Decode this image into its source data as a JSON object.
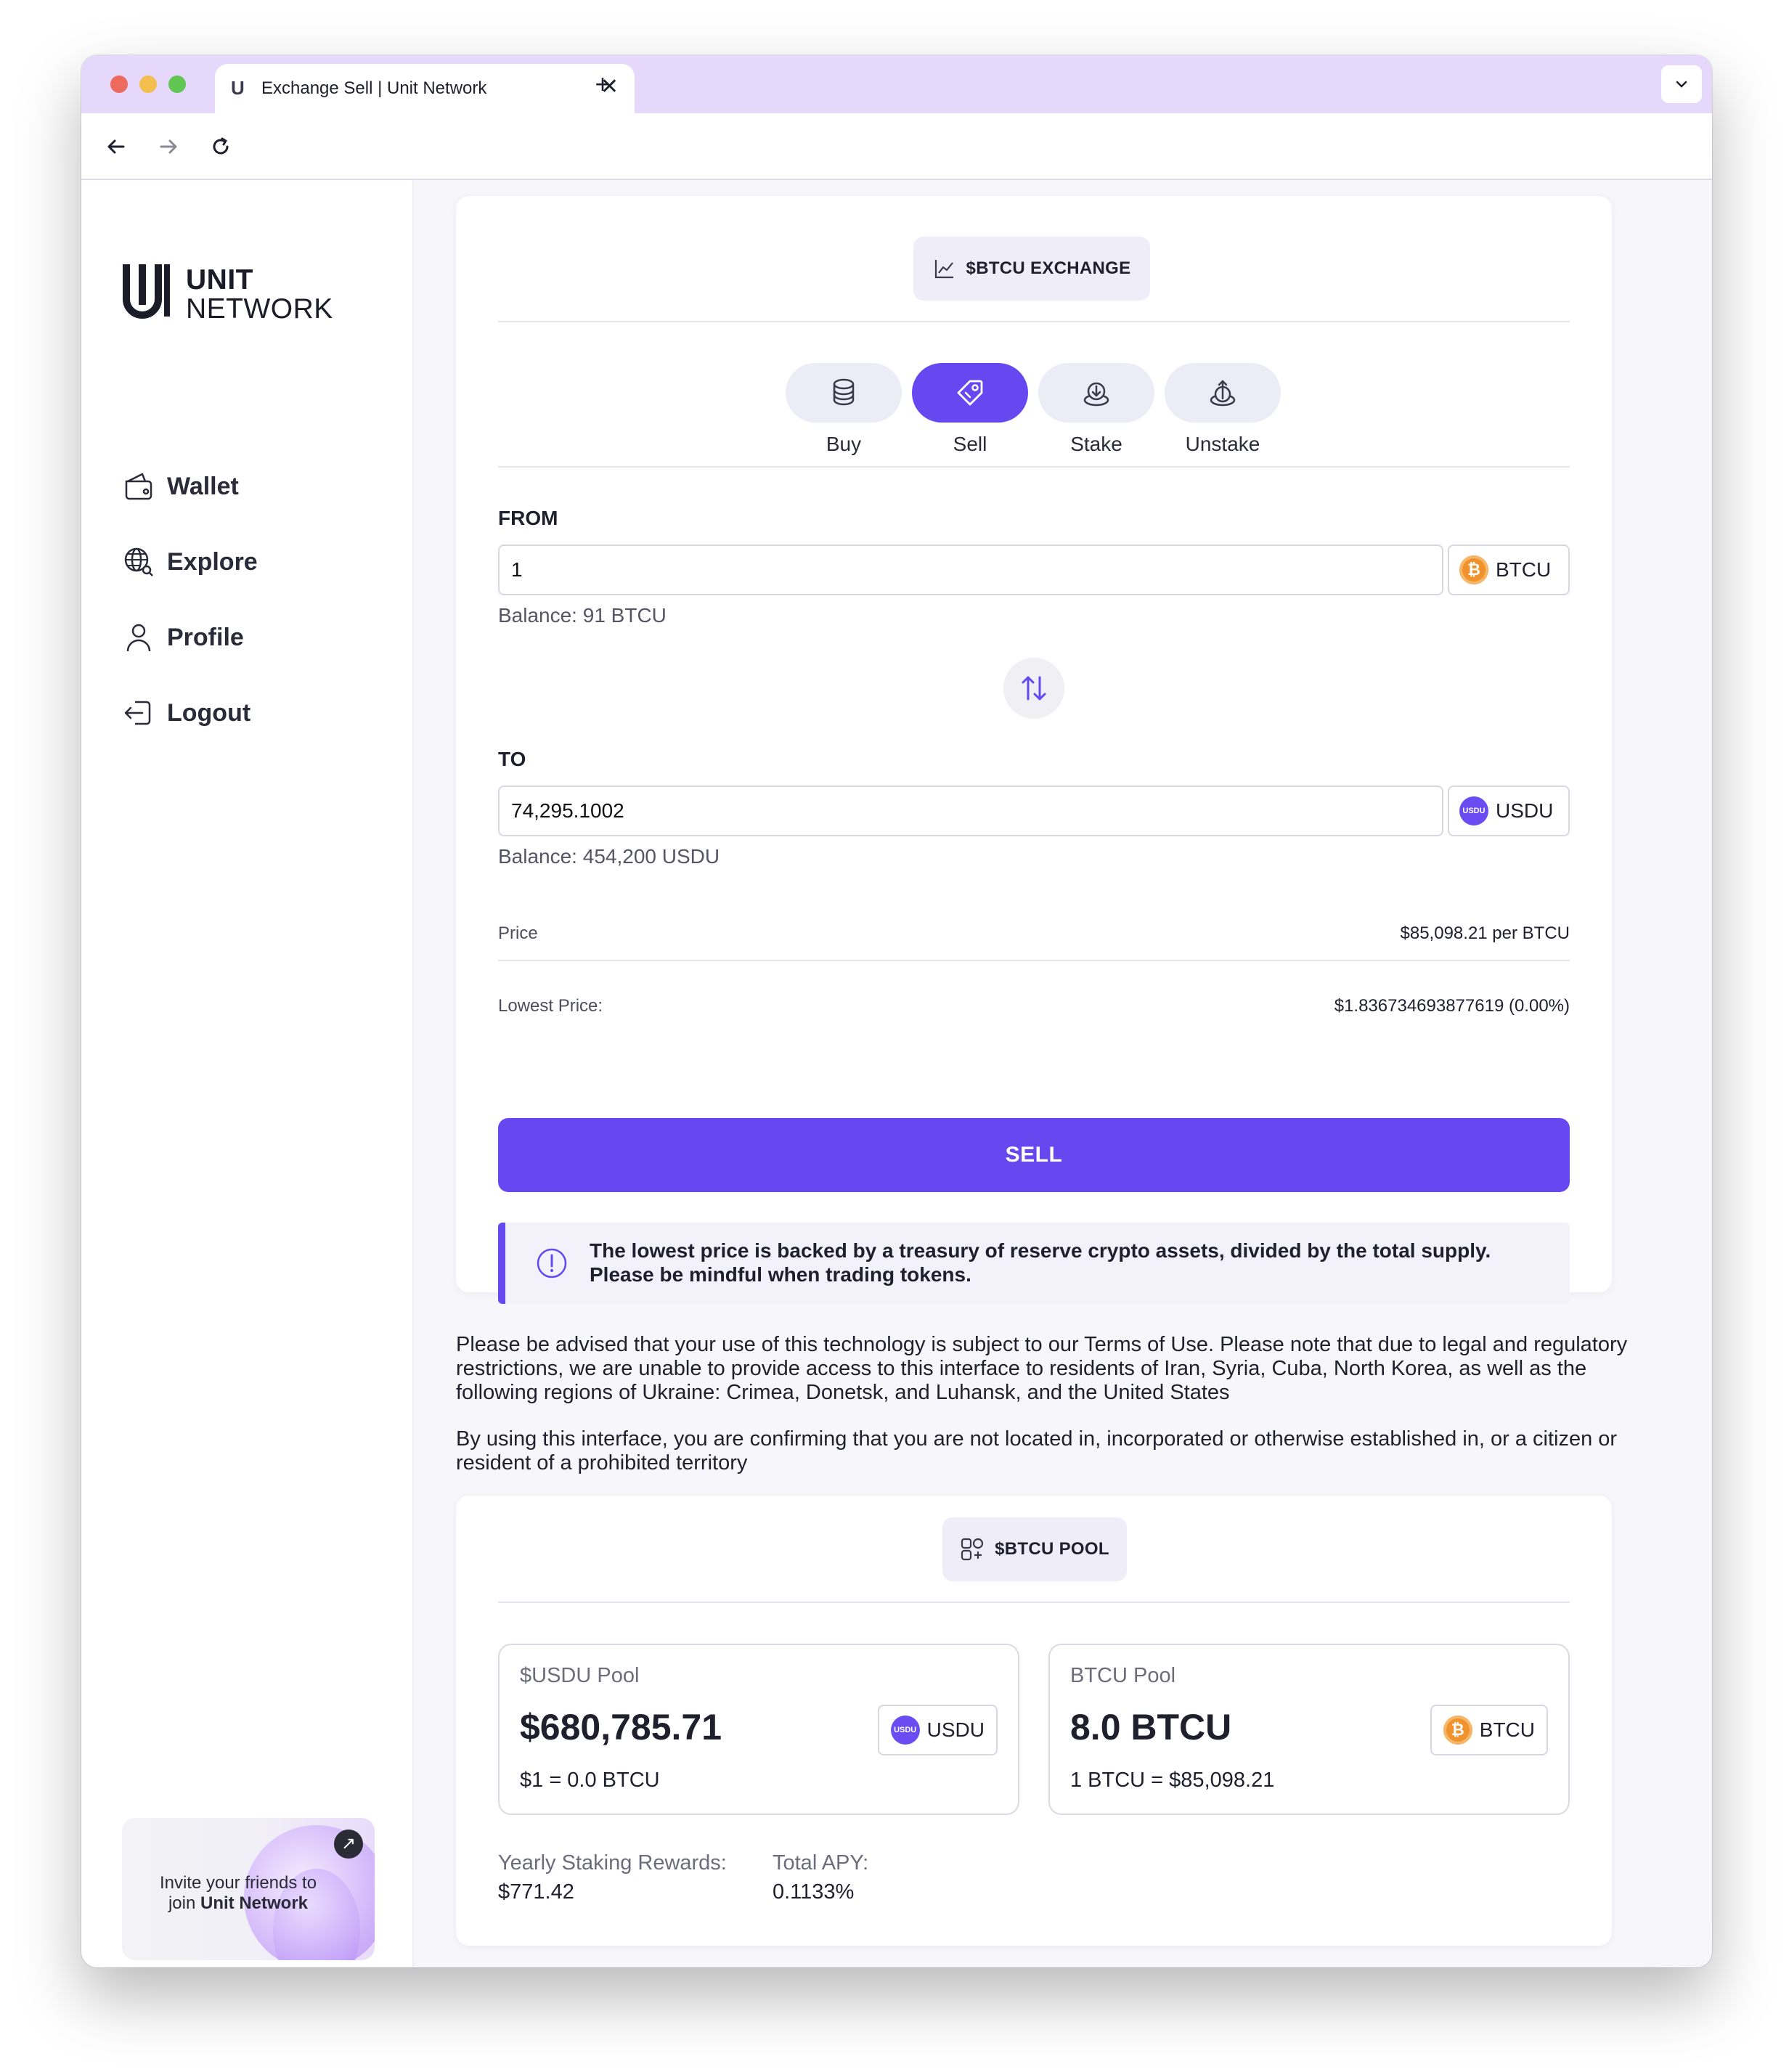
{
  "browser": {
    "tab_favicon": "U",
    "tab_title": "Exchange Sell | Unit Network",
    "close": "✕",
    "new_tab": "+",
    "menu": "⌄",
    "back": "←",
    "forward": "→",
    "reload": "↻"
  },
  "sidebar": {
    "logo": {
      "line1": "UNIT",
      "line2": "NETWORK"
    },
    "items": [
      {
        "label": "Wallet",
        "icon": "wallet-icon"
      },
      {
        "label": "Explore",
        "icon": "globe-search-icon"
      },
      {
        "label": "Profile",
        "icon": "user-icon"
      },
      {
        "label": "Logout",
        "icon": "logout-icon"
      }
    ],
    "invite": {
      "text": "Invite your friends to join",
      "brand": "Unit Network",
      "arrow": "↗"
    }
  },
  "exchange": {
    "header": "$BTCU EXCHANGE",
    "actions": [
      {
        "label": "Buy",
        "icon": "coins-icon",
        "active": false
      },
      {
        "label": "Sell",
        "icon": "tag-icon",
        "active": true
      },
      {
        "label": "Stake",
        "icon": "stake-icon",
        "active": false
      },
      {
        "label": "Unstake",
        "icon": "unstake-icon",
        "active": false
      }
    ],
    "from": {
      "label": "FROM",
      "value": "1",
      "token": "BTCU",
      "balance": "Balance: 91 BTCU"
    },
    "to": {
      "label": "TO",
      "value": "74,295.1002",
      "token": "USDU",
      "balance": "Balance: 454,200 USDU"
    },
    "price": {
      "label": "Price",
      "value": "$85,098.21 per BTCU"
    },
    "lowest_price": {
      "label": "Lowest Price:",
      "value": "$1.836734693877619 (0.00%)"
    },
    "sell_button": "SELL",
    "notice": "The lowest price is backed by a treasury of reserve crypto assets, divided by the total supply. Please be mindful when trading tokens."
  },
  "legal": {
    "p1": "Please be advised that your use of this technology is subject to our Terms of Use. Please note that due to legal and regulatory restrictions, we are unable to provide access to this interface to residents of Iran, Syria, Cuba, North Korea, as well as the following regions of Ukraine: Crimea, Donetsk, and Luhansk, and the United States",
    "p2": "By using this interface, you are confirming that you are not located in, incorporated or otherwise established in, or a citizen or resident of a prohibited territory"
  },
  "pool": {
    "header": "$BTCU POOL",
    "usdu": {
      "title": "$USDU Pool",
      "amount": "$680,785.71",
      "token": "USDU",
      "rate": "$1 = 0.0 BTCU"
    },
    "btcu": {
      "title": "BTCU Pool",
      "amount": "8.0 BTCU",
      "token": "BTCU",
      "rate": "1 BTCU = $85,098.21"
    },
    "yearly_rewards": {
      "label": "Yearly Staking Rewards:",
      "value": "$771.42"
    },
    "total_apy": {
      "label": "Total APY:",
      "value": "0.1133%"
    }
  },
  "colors": {
    "accent": "#6548f0",
    "tabbar": "#e6d8fb",
    "btc": "#f1932d"
  }
}
